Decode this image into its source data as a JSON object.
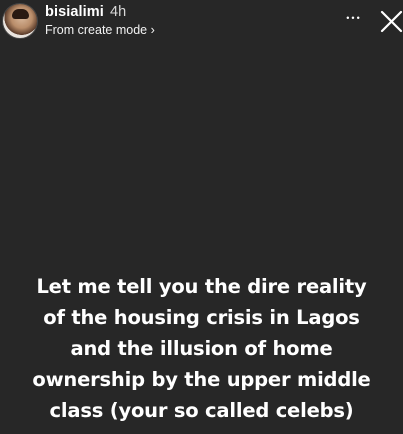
{
  "header": {
    "username": "bisialimi",
    "time": "4h",
    "subtitle": "From create mode",
    "subtitle_chevron": "›",
    "more_icon": "•••",
    "close_icon": "close-x"
  },
  "caption": {
    "lines": [
      "Let me tell you the dire reality",
      "of the housing crisis in Lagos",
      "and the illusion of home",
      "ownership by the upper middle",
      "class (your so called celebs)"
    ]
  },
  "colors": {
    "background": "#272727",
    "text": "#ffffff"
  }
}
